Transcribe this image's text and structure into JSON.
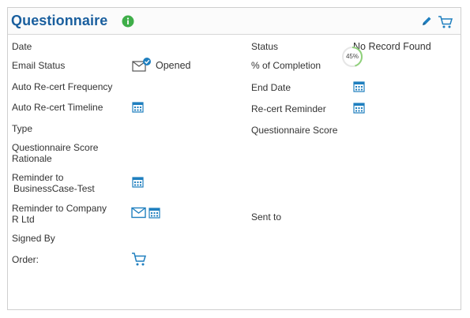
{
  "header": {
    "title": "Questionnaire"
  },
  "left": {
    "date_label": "Date",
    "email_status_label": "Email Status",
    "email_status_value": "Opened",
    "auto_recert_frequency_label": "Auto Re-cert Frequency",
    "auto_recert_timeline_label": "Auto Re-cert Timeline",
    "type_label": "Type",
    "score_rationale_line1": "Questionnaire Score",
    "score_rationale_line2": "Rationale",
    "reminder_to_line1": "Reminder to",
    "reminder_to_line2": "BusinessCase-Test",
    "reminder_company_line1": "Reminder to   Company",
    "reminder_company_line2": "R Ltd",
    "signed_by_label": "Signed By",
    "order_label": "Order:"
  },
  "right": {
    "status_label": "Status",
    "status_value": "No Record Found",
    "completion_label": "% of Completion",
    "completion_value": "45%",
    "completion_fraction": 0.45,
    "end_date_label": "End Date",
    "recert_reminder_label": "Re-cert Reminder",
    "questionnaire_score_label": "Questionnaire Score",
    "sent_to_label": "Sent to"
  },
  "colors": {
    "title": "#1a5f9e",
    "info": "#3fae49",
    "icon_blue": "#1f7fbf",
    "progress": "#8fd17a"
  }
}
